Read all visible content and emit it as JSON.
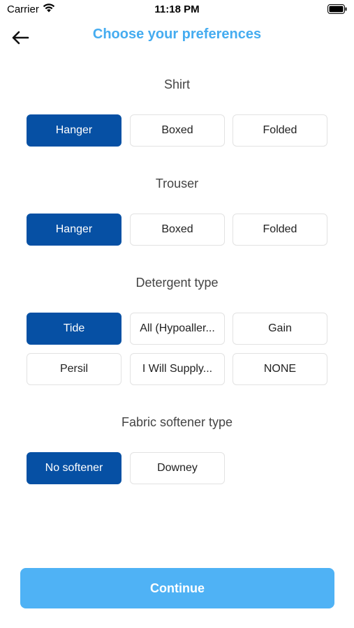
{
  "status_bar": {
    "carrier": "Carrier",
    "time": "11:18 PM"
  },
  "header": {
    "title": "Choose your preferences",
    "back_icon": "arrow-left-icon"
  },
  "sections": {
    "shirt": {
      "title": "Shirt",
      "options": [
        "Hanger",
        "Boxed",
        "Folded"
      ],
      "selected": "Hanger"
    },
    "trouser": {
      "title": "Trouser",
      "options": [
        "Hanger",
        "Boxed",
        "Folded"
      ],
      "selected": "Hanger"
    },
    "detergent": {
      "title": "Detergent type",
      "options": [
        "Tide",
        "All (Hypoaller...",
        "Gain",
        "Persil",
        "I Will Supply...",
        "NONE"
      ],
      "selected": "Tide"
    },
    "softener": {
      "title": "Fabric softener type",
      "options": [
        "No softener",
        "Downey"
      ],
      "selected": "No softener"
    }
  },
  "continue_label": "Continue",
  "colors": {
    "accent": "#45acf0",
    "selected": "#0650a4",
    "button": "#4fb2f5"
  }
}
